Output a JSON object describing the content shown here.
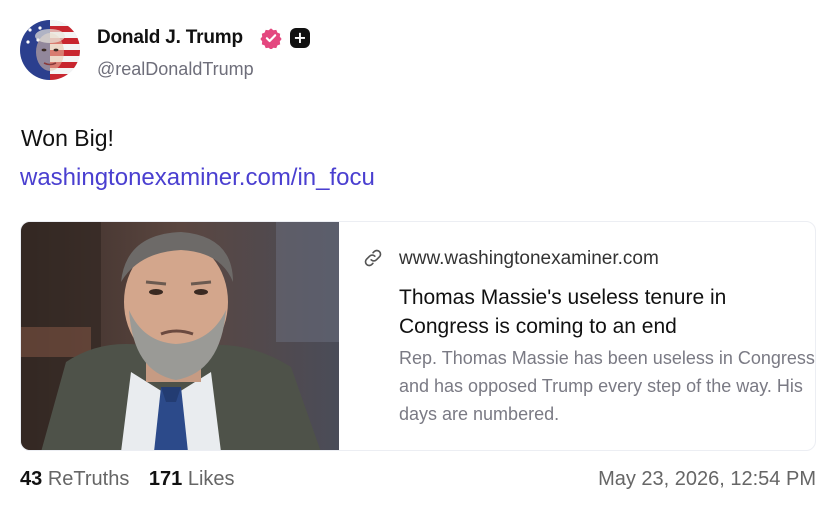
{
  "author": {
    "name": "Donald J. Trump",
    "handle": "@realDonaldTrump",
    "verified_color": "#e4477f"
  },
  "post": {
    "text": "Won Big!",
    "link_text": "washingtonexaminer.com/in_focu"
  },
  "link_card": {
    "domain": "www.washingtonexaminer.com",
    "title": "Thomas Massie's useless tenure in Congress is coming to an end",
    "description": "Rep. Thomas Massie has been useless in Congress and has opposed Trump every step of the way. His days are numbered."
  },
  "stats": {
    "retruths_count": "43",
    "retruths_label": "ReTruths",
    "likes_count": "171",
    "likes_label": "Likes",
    "timestamp": "May 23, 2026, 12:54 PM"
  },
  "colors": {
    "link": "#4a3fd0",
    "muted": "#7a7a84"
  }
}
